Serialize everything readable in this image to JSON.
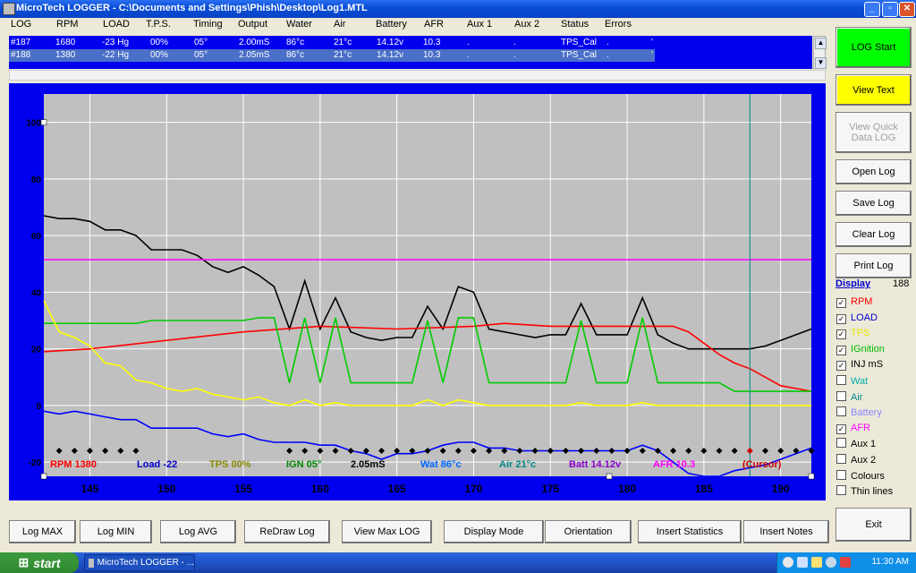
{
  "window": {
    "title": "MicroTech LOGGER   -  C:\\Documents and Settings\\Phish\\Desktop\\Log1.MTL"
  },
  "header": [
    "LOG",
    "RPM",
    "LOAD",
    "T.P.S.",
    "Timing",
    "Output",
    "Water",
    "Air",
    "Battery",
    "AFR",
    "Aux 1",
    "Aux 2",
    "Status",
    "Errors"
  ],
  "log_rows": [
    [
      "#187",
      "1680",
      "-23 Hg",
      "00%",
      "05°",
      "2.00mS",
      "86°c",
      "21°c",
      "14.12v",
      "10.3",
      ".",
      ".",
      "TPS_Cal",
      ".",
      "'"
    ],
    [
      "#188",
      "1380",
      "-22 Hg",
      "00%",
      "05°",
      "2.05mS",
      "86°c",
      "21°c",
      "14.12v",
      "10.3",
      ".",
      ".",
      "TPS_Cal",
      ".",
      "'"
    ]
  ],
  "right_buttons": {
    "log_start": "LOG Start",
    "view_text": "View Text",
    "view_quick": "View Quick Data LOG",
    "open_log": "Open Log",
    "save_log": "Save Log",
    "clear_log": "Clear Log",
    "print_log": "Print Log",
    "exit": "Exit"
  },
  "display": {
    "label": "Display",
    "count": "188"
  },
  "toggles": [
    {
      "label": "RPM",
      "checked": true,
      "color": "#ff0000"
    },
    {
      "label": "LOAD",
      "checked": true,
      "color": "#0000cc"
    },
    {
      "label": "TPS",
      "checked": true,
      "color": "#ffff00"
    },
    {
      "label": "IGnition",
      "checked": true,
      "color": "#00bb00"
    },
    {
      "label": "INJ mS",
      "checked": true,
      "color": "#000000"
    },
    {
      "label": "Wat",
      "checked": false,
      "color": "#00aaaa"
    },
    {
      "label": "Air",
      "checked": false,
      "color": "#008888"
    },
    {
      "label": "Battery",
      "checked": false,
      "color": "#8888ff"
    },
    {
      "label": "AFR",
      "checked": true,
      "color": "#ff00ff"
    },
    {
      "label": "Aux 1",
      "checked": false,
      "color": "#000000"
    },
    {
      "label": "Aux 2",
      "checked": false,
      "color": "#000000"
    },
    {
      "label": "Colours",
      "checked": false,
      "color": "#000000"
    },
    {
      "label": "Thin lines",
      "checked": false,
      "color": "#000000"
    }
  ],
  "bottom_buttons": [
    "Log MAX",
    "Log MIN",
    "Log AVG",
    "ReDraw Log",
    "View Max LOG",
    "Display Mode",
    "Orientation",
    "Insert Statistics",
    "Insert Notes"
  ],
  "legend": [
    {
      "text": "RPM 1380",
      "color": "#ff0000"
    },
    {
      "text": "Load -22",
      "color": "#0000cc"
    },
    {
      "text": "TPS 00%",
      "color": "#888800"
    },
    {
      "text": "IGN 05°",
      "color": "#008800"
    },
    {
      "text": "2.05mS",
      "color": "#000000"
    },
    {
      "text": "Wat 86°c",
      "color": "#0066ff"
    },
    {
      "text": "Air 21°c",
      "color": "#008888"
    },
    {
      "text": "Batt 14.12v",
      "color": "#8800cc"
    },
    {
      "text": "AFR 10.3",
      "color": "#ff00ff"
    },
    {
      "text": "(Cursor)",
      "color": "#cc0000"
    }
  ],
  "taskbar": {
    "start": "start",
    "task": "MicroTech LOGGER  - ...",
    "clock": "11:30 AM"
  },
  "chart_data": {
    "type": "line",
    "xlim": [
      142,
      192
    ],
    "ylim": [
      -25,
      110
    ],
    "x_ticks": [
      145,
      150,
      155,
      160,
      165,
      170,
      175,
      180,
      185,
      190
    ],
    "y_ticks": [
      -20,
      0,
      20,
      40,
      60,
      80,
      100
    ],
    "cursor_x": 188,
    "grid": true,
    "series": [
      {
        "key": "inj",
        "color": "#000000",
        "x": [
          142,
          143,
          144,
          145,
          146,
          147,
          148,
          149,
          150,
          151,
          152,
          153,
          154,
          155,
          156,
          157,
          158,
          159,
          160,
          161,
          162,
          163,
          164,
          165,
          166,
          167,
          168,
          169,
          170,
          171,
          172,
          173,
          174,
          175,
          176,
          177,
          178,
          179,
          180,
          181,
          182,
          183,
          184,
          185,
          186,
          187,
          188,
          189,
          190,
          191,
          192
        ],
        "y": [
          67,
          66,
          66,
          65,
          62,
          62,
          60,
          55,
          55,
          55,
          53,
          49,
          47,
          49,
          46,
          42,
          27,
          44,
          27,
          38,
          26,
          24,
          23,
          24,
          24,
          35,
          27,
          42,
          40,
          27,
          26,
          25,
          24,
          25,
          25,
          36,
          25,
          25,
          25,
          38,
          25,
          22,
          20,
          20,
          20,
          20,
          20,
          21,
          23,
          25,
          27
        ]
      },
      {
        "key": "rpm",
        "color": "#ff0000",
        "x": [
          142,
          145,
          150,
          155,
          160,
          165,
          170,
          172,
          175,
          180,
          183,
          184,
          185,
          186,
          187,
          188,
          189,
          190,
          191,
          192
        ],
        "y": [
          19,
          20,
          23,
          26,
          28,
          27,
          28,
          29,
          28,
          28,
          28,
          26,
          22,
          18,
          15,
          13,
          10,
          7,
          6,
          5
        ]
      },
      {
        "key": "ign",
        "color": "#00cc00",
        "x": [
          142,
          143,
          144,
          145,
          146,
          147,
          148,
          149,
          150,
          151,
          152,
          153,
          154,
          155,
          156,
          157,
          158,
          159,
          160,
          161,
          162,
          163,
          164,
          165,
          166,
          167,
          168,
          169,
          170,
          171,
          172,
          173,
          174,
          175,
          176,
          177,
          178,
          179,
          180,
          181,
          182,
          183,
          184,
          185,
          186,
          187,
          188,
          189,
          190,
          191,
          192
        ],
        "y": [
          29,
          29,
          29,
          29,
          29,
          29,
          29,
          30,
          30,
          30,
          30,
          30,
          30,
          30,
          31,
          31,
          8,
          31,
          8,
          31,
          8,
          8,
          8,
          8,
          8,
          30,
          8,
          31,
          31,
          8,
          8,
          8,
          8,
          8,
          8,
          30,
          8,
          8,
          8,
          31,
          8,
          8,
          8,
          8,
          8,
          5,
          5,
          5,
          5,
          5,
          5
        ]
      },
      {
        "key": "tps",
        "color": "#ffff00",
        "x": [
          142,
          143,
          144,
          145,
          146,
          147,
          148,
          149,
          150,
          151,
          152,
          153,
          154,
          155,
          156,
          157,
          158,
          159,
          160,
          161,
          162,
          163,
          164,
          165,
          166,
          167,
          168,
          169,
          170,
          171,
          172,
          173,
          174,
          175,
          176,
          177,
          178,
          179,
          180,
          181,
          182,
          183,
          184,
          185,
          186,
          187,
          188,
          189,
          190,
          191,
          192
        ],
        "y": [
          37,
          26,
          24,
          21,
          15,
          14,
          9,
          8,
          6,
          5,
          6,
          4,
          3,
          2,
          3,
          1,
          0,
          2,
          0,
          1,
          0,
          0,
          0,
          0,
          0,
          2,
          0,
          2,
          1,
          0,
          0,
          0,
          0,
          0,
          0,
          1,
          0,
          0,
          0,
          1,
          0,
          0,
          0,
          0,
          0,
          0,
          0,
          0,
          0,
          0,
          0
        ]
      },
      {
        "key": "load",
        "color": "#0000ff",
        "x": [
          142,
          143,
          144,
          145,
          146,
          147,
          148,
          149,
          150,
          151,
          152,
          153,
          154,
          155,
          156,
          157,
          158,
          159,
          160,
          161,
          162,
          163,
          164,
          165,
          166,
          167,
          168,
          169,
          170,
          171,
          172,
          173,
          174,
          175,
          176,
          177,
          178,
          179,
          180,
          181,
          182,
          183,
          184,
          185,
          186,
          187,
          188,
          189,
          190,
          191,
          192
        ],
        "y": [
          -2,
          -3,
          -2,
          -3,
          -4,
          -5,
          -5,
          -8,
          -8,
          -8,
          -8,
          -10,
          -11,
          -10,
          -12,
          -13,
          -13,
          -13,
          -14,
          -14,
          -16,
          -17,
          -19,
          -17,
          -17,
          -16,
          -14,
          -13,
          -13,
          -15,
          -15,
          -16,
          -16,
          -16,
          -16,
          -16,
          -16,
          -16,
          -16,
          -14,
          -16,
          -20,
          -24,
          -25,
          -25,
          -23,
          -22,
          -21,
          -19,
          -17,
          -15
        ]
      },
      {
        "key": "afr",
        "color": "#ff00ff",
        "x": [
          142,
          192
        ],
        "y": [
          51.5,
          51.5
        ]
      }
    ],
    "markers": {
      "y": -16,
      "x": [
        143,
        144,
        145,
        146,
        147,
        148,
        158,
        159,
        160,
        161,
        162,
        163,
        164,
        165,
        166,
        167,
        168,
        169,
        170,
        171,
        172,
        173,
        174,
        175,
        176,
        177,
        178,
        179,
        180,
        181,
        182,
        183,
        184,
        185,
        186,
        187,
        188,
        189,
        190,
        191,
        192
      ]
    }
  }
}
